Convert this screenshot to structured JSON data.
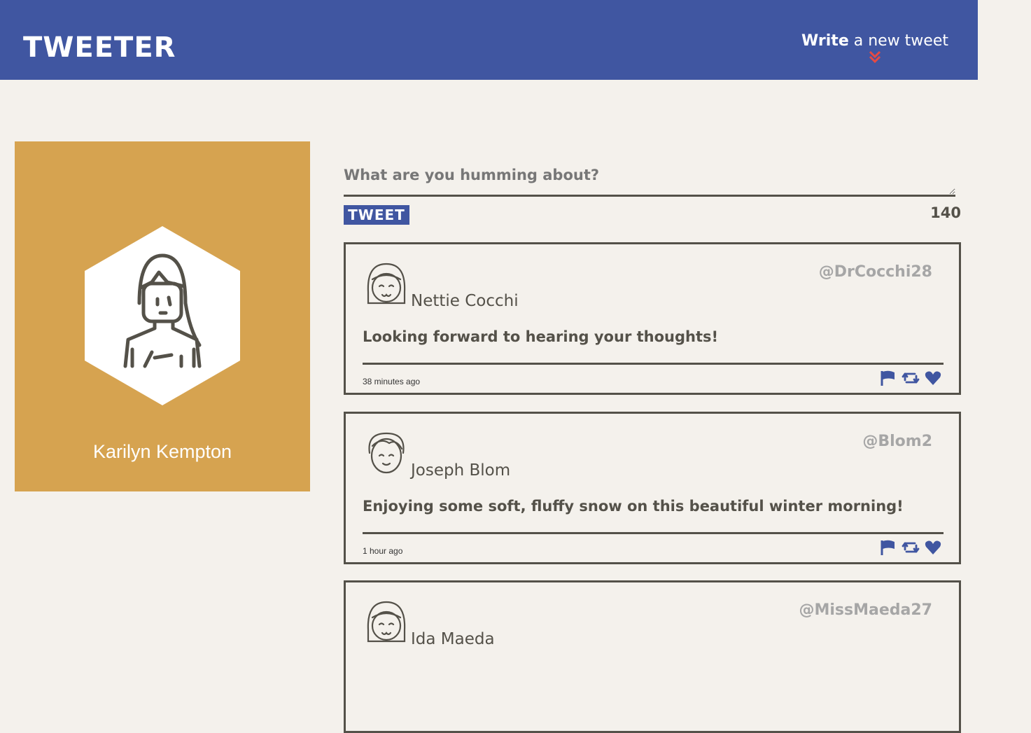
{
  "navbar": {
    "logo": "TWEETER",
    "compose_bold": "Write",
    "compose_rest": " a new tweet",
    "compose_icon": "double-chevron-down-icon"
  },
  "profile": {
    "first_name": "Karilyn",
    "last_name": "Kempton",
    "avatar_icon": "user-avatar-icon"
  },
  "new_tweet": {
    "placeholder": "What are you humming about?",
    "button_label": "TWEET",
    "counter": "140"
  },
  "tweets": [
    {
      "name": "Nettie Cocchi",
      "handle": "@DrCocchi28",
      "content": "Looking forward to hearing your thoughts!",
      "time": "38 minutes ago"
    },
    {
      "name": "Joseph Blom",
      "handle": "@Blom2",
      "content": "Enjoying some soft, fluffy snow on this beautiful winter morning!",
      "time": "1 hour ago"
    },
    {
      "name": "Ida Maeda",
      "handle": "@MissMaeda27",
      "content": "",
      "time": ""
    }
  ],
  "colors": {
    "navbar": "#4056a1",
    "profile_bg": "#d6a350",
    "page_bg": "#f4f1ec",
    "action_icons": "#4056a1",
    "chevron": "#e54a43"
  }
}
